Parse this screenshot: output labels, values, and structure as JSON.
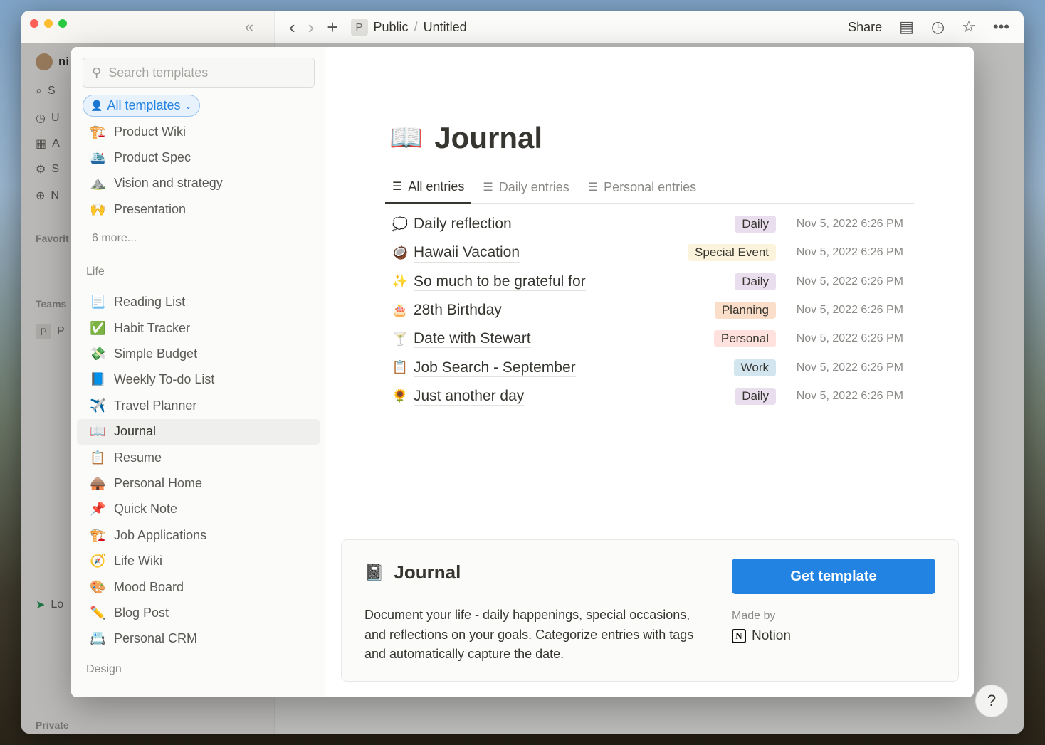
{
  "topbar": {
    "workspace_badge": "P",
    "crumb_parent": "Public",
    "crumb_separator": "/",
    "crumb_page": "Untitled",
    "share_label": "Share"
  },
  "background_sidebar": {
    "user_initial": "ni",
    "rows": [
      "S",
      "U",
      "A",
      "S",
      "N"
    ],
    "favorites_label": "Favorit",
    "teams_label": "Teams",
    "team_badge": "P",
    "team_name": "P",
    "lo_label": "Lo",
    "private_label": "Private"
  },
  "modal": {
    "search": {
      "placeholder": "Search templates"
    },
    "filter": {
      "label": "All templates"
    },
    "top_templates": [
      {
        "icon": "🏗️",
        "label": "Product Wiki"
      },
      {
        "icon": "🛳️",
        "label": "Product Spec"
      },
      {
        "icon": "⛰️",
        "label": "Vision and strategy"
      },
      {
        "icon": "🙌",
        "label": "Presentation"
      }
    ],
    "more_label": "6 more...",
    "life_section": "Life",
    "life_templates": [
      {
        "icon": "📃",
        "label": "Reading List"
      },
      {
        "icon": "✅",
        "label": "Habit Tracker"
      },
      {
        "icon": "💸",
        "label": "Simple Budget"
      },
      {
        "icon": "📘",
        "label": "Weekly To-do List"
      },
      {
        "icon": "✈️",
        "label": "Travel Planner"
      },
      {
        "icon": "📖",
        "label": "Journal"
      },
      {
        "icon": "📋",
        "label": "Resume"
      },
      {
        "icon": "🛖",
        "label": "Personal Home"
      },
      {
        "icon": "📌",
        "label": "Quick Note"
      },
      {
        "icon": "🏗️",
        "label": "Job Applications"
      },
      {
        "icon": "🧭",
        "label": "Life Wiki"
      },
      {
        "icon": "🎨",
        "label": "Mood Board"
      },
      {
        "icon": "✏️",
        "label": "Blog Post"
      },
      {
        "icon": "📇",
        "label": "Personal CRM"
      }
    ],
    "design_section": "Design",
    "preview": {
      "icon": "📖",
      "title": "Journal",
      "views": [
        "All entries",
        "Daily entries",
        "Personal entries"
      ],
      "entries": [
        {
          "icon": "💭",
          "title": "Daily reflection",
          "tag": "Daily",
          "tag_color": "#e8deee",
          "date": "Nov 5, 2022 6:26 PM"
        },
        {
          "icon": "🥥",
          "title": "Hawaii Vacation",
          "tag": "Special Event",
          "tag_color": "#fbf3db",
          "date": "Nov 5, 2022 6:26 PM"
        },
        {
          "icon": "✨",
          "title": "So much to be grateful for",
          "tag": "Daily",
          "tag_color": "#e8deee",
          "date": "Nov 5, 2022 6:26 PM"
        },
        {
          "icon": "🎂",
          "title": "28th Birthday",
          "tag": "Planning",
          "tag_color": "#fadec9",
          "date": "Nov 5, 2022 6:26 PM"
        },
        {
          "icon": "🍸",
          "title": "Date with Stewart",
          "tag": "Personal",
          "tag_color": "#ffe2dd",
          "date": "Nov 5, 2022 6:26 PM"
        },
        {
          "icon": "📋",
          "title": "Job Search - September",
          "tag": "Work",
          "tag_color": "#d3e5ef",
          "date": "Nov 5, 2022 6:26 PM"
        },
        {
          "icon": "🌻",
          "title": "Just another day",
          "tag": "Daily",
          "tag_color": "#e8deee",
          "date": "Nov 5, 2022 6:26 PM"
        }
      ]
    },
    "info": {
      "icon": "📓",
      "title": "Journal",
      "description": "Document your life - daily happenings, special occasions, and reflections on your goals. Categorize entries with tags and automatically capture the date.",
      "button_label": "Get template",
      "made_by_label": "Made by",
      "made_by_logo": "N",
      "made_by_name": "Notion"
    }
  },
  "help_label": "?"
}
